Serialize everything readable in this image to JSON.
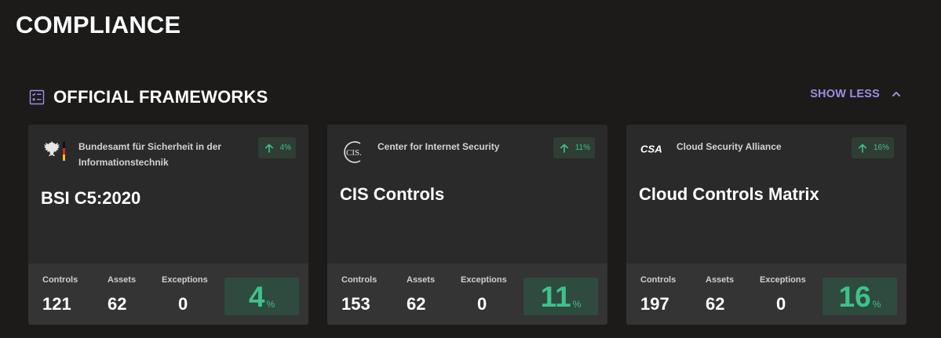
{
  "page": {
    "title": "COMPLIANCE"
  },
  "section": {
    "title": "OFFICIAL FRAMEWORKS",
    "icon": "checklist-icon",
    "toggle_label": "SHOW LESS"
  },
  "colors": {
    "accent": "#9b8fe0",
    "success": "#3ec28a",
    "card_bg": "#2a2a2a",
    "page_bg": "#1c1b1a"
  },
  "cards": [
    {
      "logo": "german-eagle-logo",
      "provider": "Bundesamt für Sicherheit in der Informationstechnik",
      "delta": "4%",
      "name": "BSI C5:2020",
      "stats": [
        {
          "label": "Controls",
          "value": "121"
        },
        {
          "label": "Assets",
          "value": "62"
        },
        {
          "label": "Exceptions",
          "value": "0"
        }
      ],
      "score": "4",
      "score_unit": "%"
    },
    {
      "logo": "cis-logo",
      "provider": "Center for Internet Security",
      "delta": "11%",
      "name": "CIS Controls",
      "stats": [
        {
          "label": "Controls",
          "value": "153"
        },
        {
          "label": "Assets",
          "value": "62"
        },
        {
          "label": "Exceptions",
          "value": "0"
        }
      ],
      "score": "11",
      "score_unit": "%"
    },
    {
      "logo": "csa-logo",
      "provider": "Cloud Security Alliance",
      "delta": "16%",
      "name": "Cloud Controls Matrix",
      "stats": [
        {
          "label": "Controls",
          "value": "197"
        },
        {
          "label": "Assets",
          "value": "62"
        },
        {
          "label": "Exceptions",
          "value": "0"
        }
      ],
      "score": "16",
      "score_unit": "%"
    }
  ]
}
